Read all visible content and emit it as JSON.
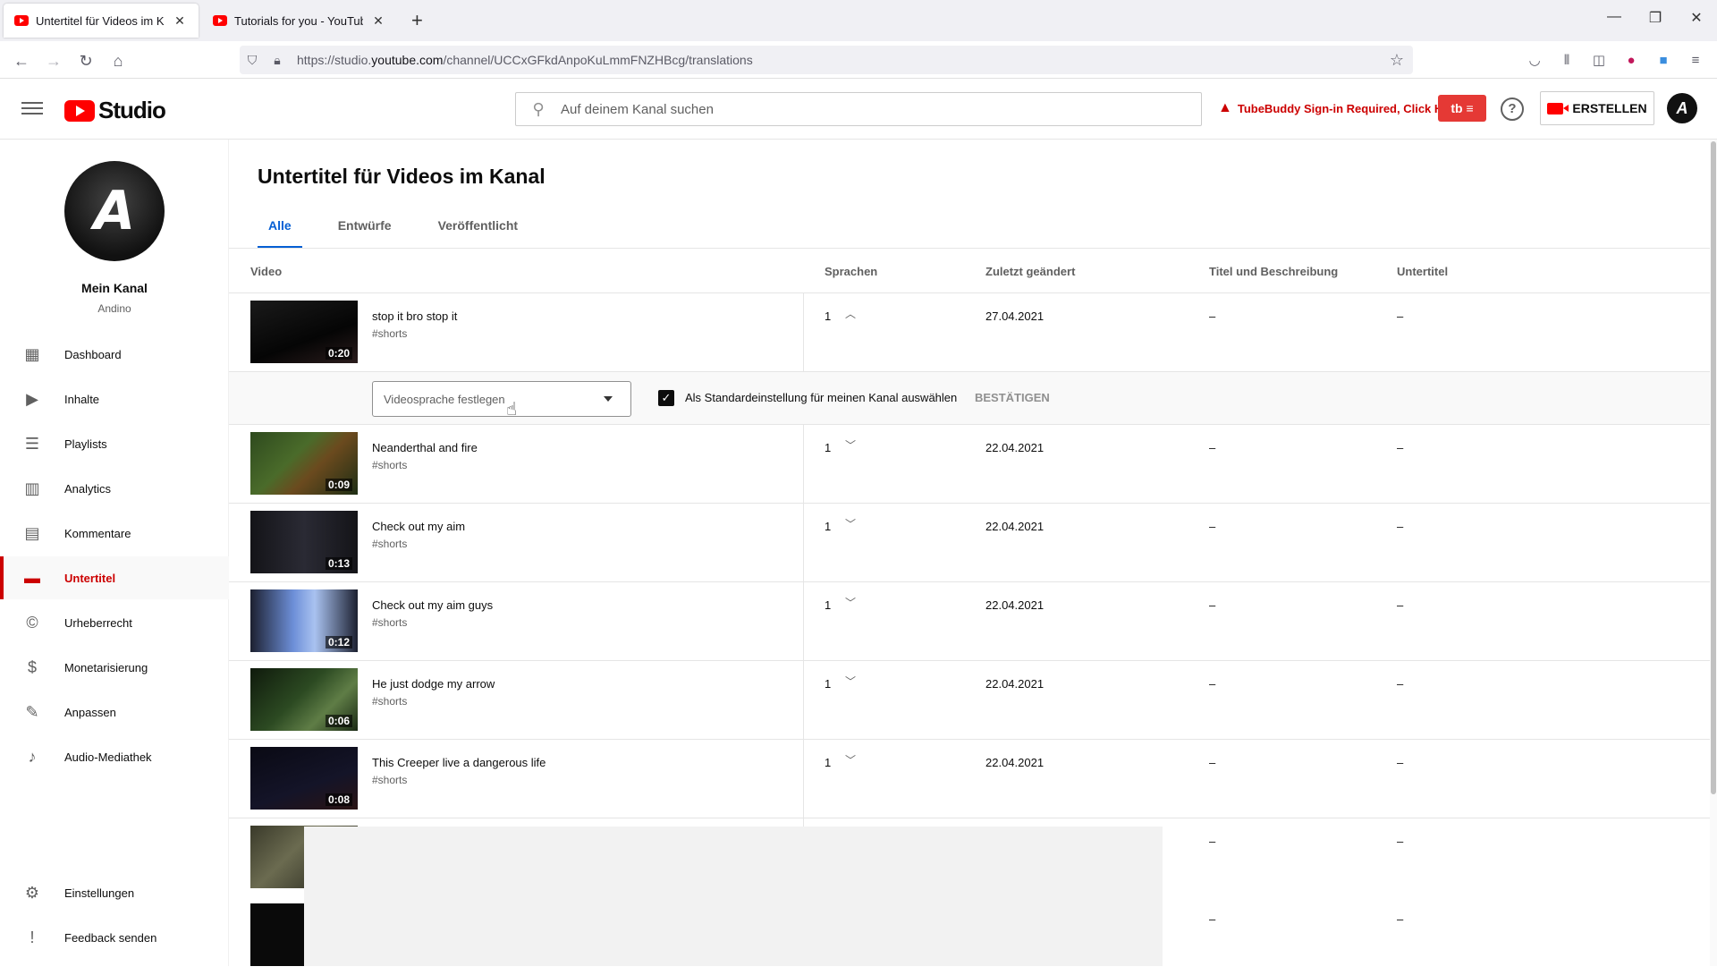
{
  "browser": {
    "tabs": [
      {
        "title": "Untertitel für Videos im Kanal -",
        "close": "✕"
      },
      {
        "title": "Tutorials for you - YouTube",
        "close": "✕"
      }
    ],
    "new_tab": "+",
    "url_prefix": "https://studio.",
    "url_domain": "youtube.com",
    "url_path": "/channel/UCCxGFkdAnpoKuLmmFNZHBcg/translations",
    "window": {
      "minimize": "—",
      "restore": "❐",
      "close": "✕"
    }
  },
  "header": {
    "logo_text": "Studio",
    "search_placeholder": "Auf deinem Kanal suchen",
    "tubebuddy_warning": "TubeBuddy Sign-in Required, Click Here",
    "tubebuddy_btn": "tb ≡",
    "help": "?",
    "create_label": "ERSTELLEN",
    "avatar_letter": "A"
  },
  "sidebar": {
    "channel_name": "Mein Kanal",
    "channel_sub": "Andino",
    "avatar_text": "A",
    "items": [
      {
        "label": "Dashboard",
        "icon": "▦"
      },
      {
        "label": "Inhalte",
        "icon": "▶"
      },
      {
        "label": "Playlists",
        "icon": "☰"
      },
      {
        "label": "Analytics",
        "icon": "▥"
      },
      {
        "label": "Kommentare",
        "icon": "▤"
      },
      {
        "label": "Untertitel",
        "icon": "▬"
      },
      {
        "label": "Urheberrecht",
        "icon": "©"
      },
      {
        "label": "Monetarisierung",
        "icon": "$"
      },
      {
        "label": "Anpassen",
        "icon": "✎"
      },
      {
        "label": "Audio-Mediathek",
        "icon": "♪"
      }
    ],
    "bottom_items": [
      {
        "label": "Einstellungen",
        "icon": "⚙"
      },
      {
        "label": "Feedback senden",
        "icon": "!"
      }
    ]
  },
  "main": {
    "title": "Untertitel für Videos im Kanal",
    "tabs": [
      "Alle",
      "Entwürfe",
      "Veröffentlicht"
    ],
    "columns": {
      "video": "Video",
      "languages": "Sprachen",
      "changed": "Zuletzt geändert",
      "title_desc": "Titel und Beschreibung",
      "subtitles": "Untertitel"
    },
    "expand": {
      "select_placeholder": "Videosprache festlegen",
      "checkbox_label": "Als Standardeinstellung für meinen Kanal auswählen",
      "confirm": "BESTÄTIGEN",
      "check": "✓"
    },
    "videos": [
      {
        "title": "stop it bro stop it",
        "desc": "#shorts",
        "duration": "0:20",
        "langs": "1",
        "chevron": "︿",
        "date": "27.04.2021",
        "td": "–",
        "sub": "–"
      },
      {
        "title": "Neanderthal and fire",
        "desc": "#shorts",
        "duration": "0:09",
        "langs": "1",
        "chevron": "﹀",
        "date": "22.04.2021",
        "td": "–",
        "sub": "–"
      },
      {
        "title": "Check out my aim",
        "desc": "#shorts",
        "duration": "0:13",
        "langs": "1",
        "chevron": "﹀",
        "date": "22.04.2021",
        "td": "–",
        "sub": "–"
      },
      {
        "title": "Check out my aim guys",
        "desc": "#shorts",
        "duration": "0:12",
        "langs": "1",
        "chevron": "﹀",
        "date": "22.04.2021",
        "td": "–",
        "sub": "–"
      },
      {
        "title": "He just dodge my arrow",
        "desc": "#shorts",
        "duration": "0:06",
        "langs": "1",
        "chevron": "﹀",
        "date": "22.04.2021",
        "td": "–",
        "sub": "–"
      },
      {
        "title": "This Creeper live a dangerous life",
        "desc": "#shorts",
        "duration": "0:08",
        "langs": "1",
        "chevron": "﹀",
        "date": "22.04.2021",
        "td": "–",
        "sub": "–"
      },
      {
        "title": "",
        "desc": "",
        "duration": "",
        "langs": "",
        "chevron": "",
        "date": "",
        "td": "–",
        "sub": "–"
      },
      {
        "title": "",
        "desc": "",
        "duration": "",
        "langs": "",
        "chevron": "",
        "date": "",
        "td": "–",
        "sub": "–"
      }
    ]
  }
}
